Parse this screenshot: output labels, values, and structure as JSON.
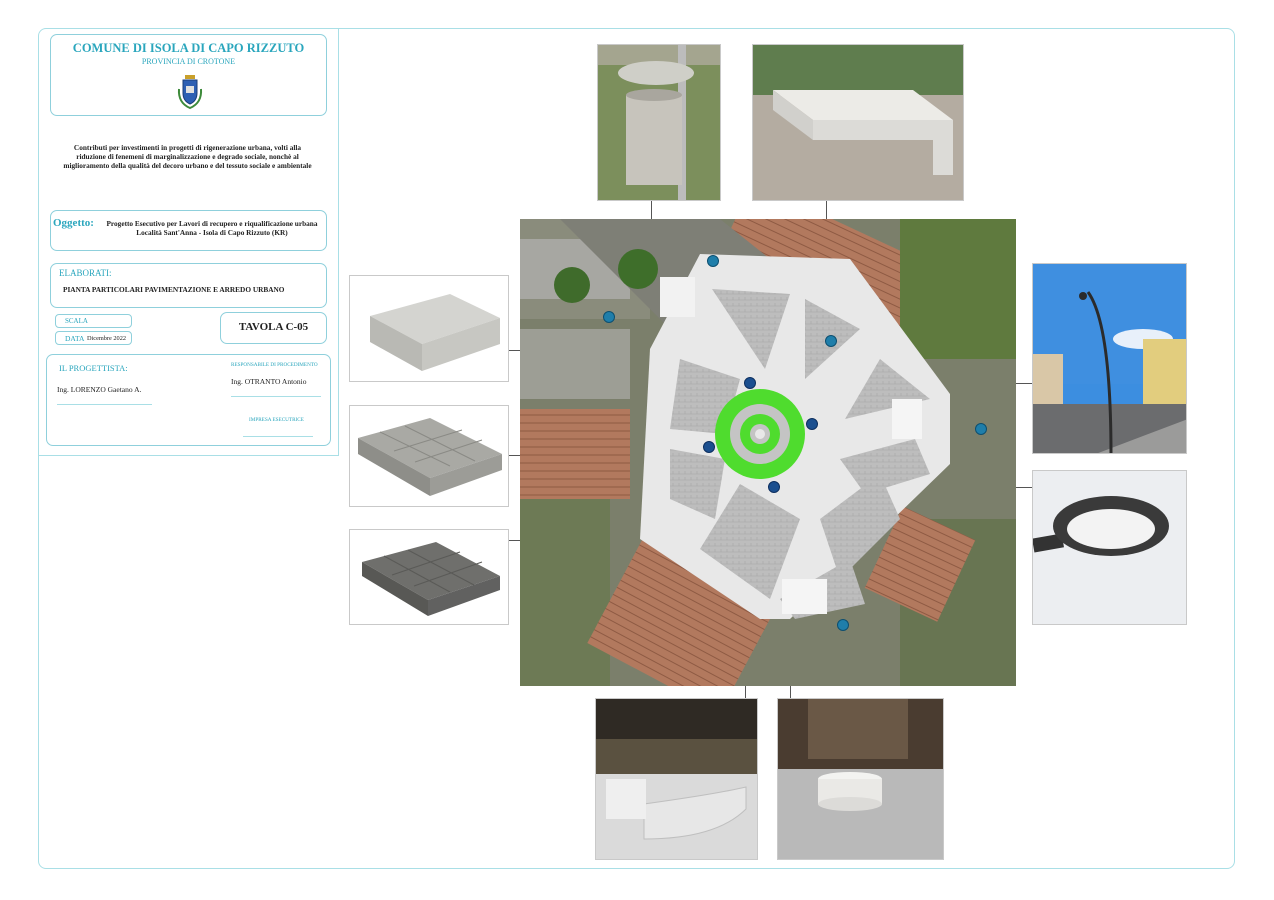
{
  "header": {
    "municipality": "COMUNE DI ISOLA DI CAPO RIZZUTO",
    "province": "PROVINCIA DI CROTONE"
  },
  "funding_text": "Contributi per investimenti in progetti di rigenerazione urbana, volti alla riduzione di fenemeni di marginalizzazione e degrado sociale, nonchè al miglioramento della qualità del decoro urbano e del tessuto sociale e ambientale",
  "subject": {
    "label": "Oggetto:",
    "text": "Progetto Esecutivo per Lavori di recupero e riqualificazione urbana Località Sant'Anna - Isola di Capo Rizzuto (KR)"
  },
  "elaborati": {
    "label": "ELABORATI:",
    "title": "PIANTA PARTICOLARI PAVIMENTAZIONE E ARREDO URBANO"
  },
  "scala": {
    "label": "SCALA",
    "value": ""
  },
  "data": {
    "label": "DATA",
    "value": "Dicembre 2022"
  },
  "tavola": "TAVOLA  C-05",
  "progettista": {
    "label": "IL PROGETTISTA:",
    "name": "Ing. LORENZO Gaetano A."
  },
  "responsabile": {
    "label": "RESPONSABILE DI PROCEDIMENTO",
    "name": "Ing. OTRANTO Antonio"
  },
  "impresa": {
    "label": "IMPRESA ESECUTRICE",
    "name": ""
  },
  "colors": {
    "teal": "#2aa6bd",
    "border": "#8fd0dc",
    "pin": "#1f7eaa",
    "roundabout_green": "#4fdc2e",
    "paving_grey": "#b9b9b9"
  },
  "photos": [
    {
      "name": "litter-bin",
      "icon": "trash-bin-photo"
    },
    {
      "name": "bench",
      "icon": "bench-photo"
    },
    {
      "name": "paver-single",
      "icon": "paver-photo"
    },
    {
      "name": "paver-light-grey",
      "icon": "paver-photo"
    },
    {
      "name": "paver-dark-grey",
      "icon": "paver-photo"
    },
    {
      "name": "street-lamp",
      "icon": "lamp-photo"
    },
    {
      "name": "lamp-head",
      "icon": "lamp-photo"
    },
    {
      "name": "curved-bench",
      "icon": "bench-photo"
    },
    {
      "name": "round-seat",
      "icon": "seat-photo"
    }
  ]
}
